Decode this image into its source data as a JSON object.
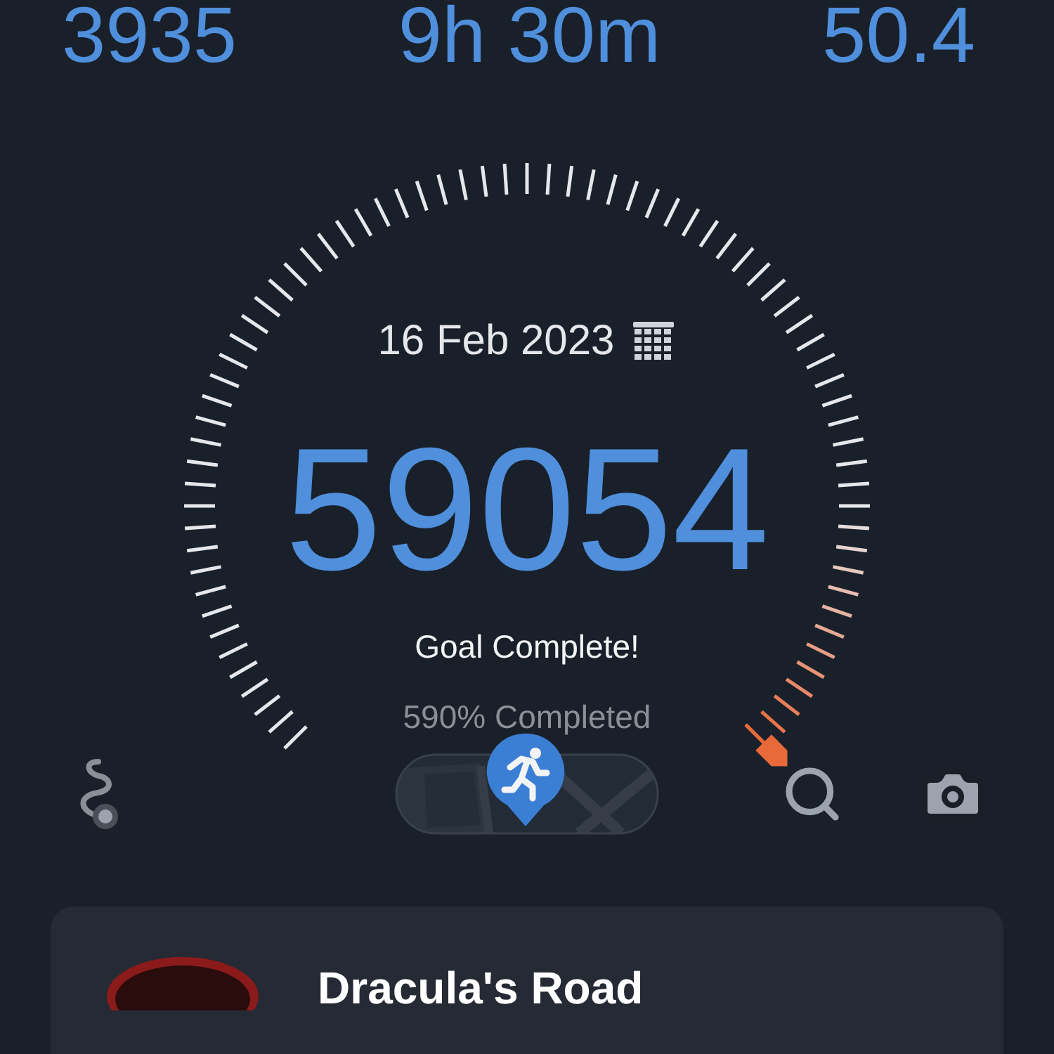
{
  "stats": [
    "3935",
    "9h 30m",
    "50.4"
  ],
  "gauge": {
    "date": "16 Feb 2023",
    "steps": "59054",
    "status": "Goal Complete!",
    "percent": "590% Completed"
  },
  "card": {
    "title": "Dracula's Road"
  }
}
